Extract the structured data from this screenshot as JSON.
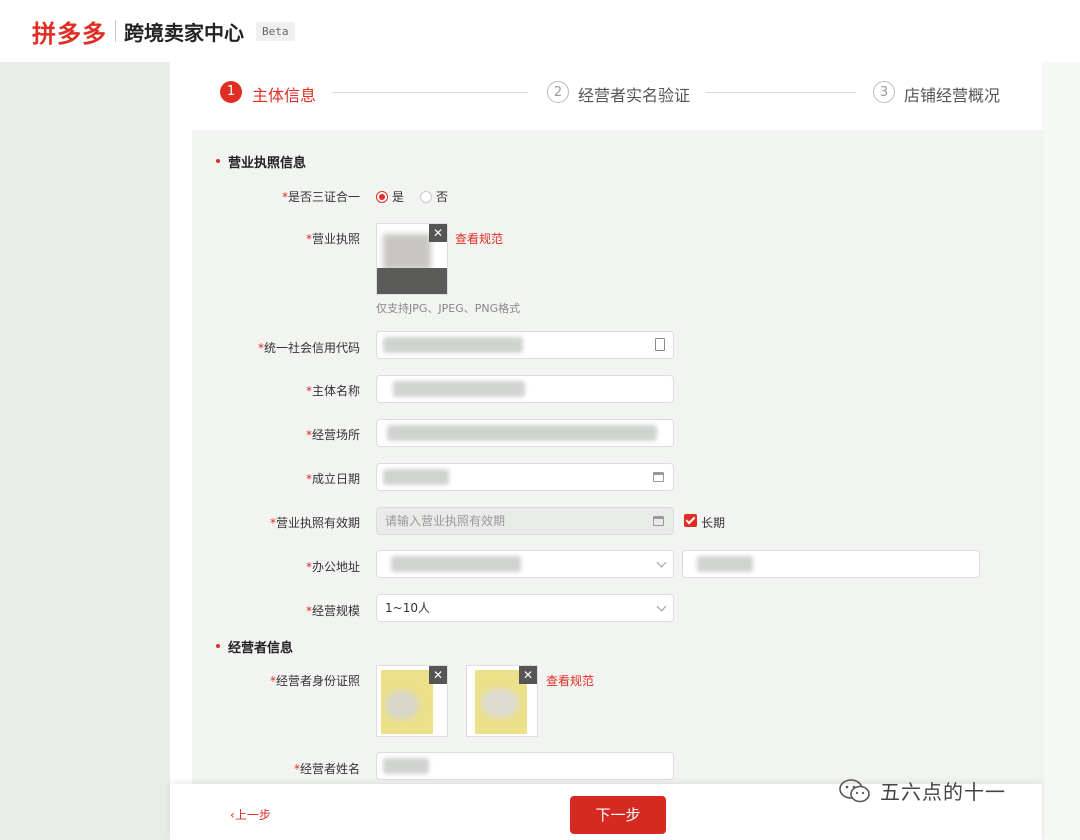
{
  "header": {
    "logo": "拼多多",
    "title": "跨境卖家中心",
    "badge": "Beta"
  },
  "steps": [
    {
      "num": "1",
      "label": "主体信息"
    },
    {
      "num": "2",
      "label": "经营者实名验证"
    },
    {
      "num": "3",
      "label": "店铺经营概况"
    }
  ],
  "sections": {
    "license": "营业执照信息",
    "operator": "经营者信息"
  },
  "fields": {
    "three_in_one": {
      "label": "是否三证合一",
      "yes": "是",
      "no": "否"
    },
    "license": {
      "label": "营业执照",
      "link": "查看规范",
      "hint": "仅支持JPG、JPEG、PNG格式"
    },
    "credit_code": {
      "label": "统一社会信用代码"
    },
    "entity_name": {
      "label": "主体名称"
    },
    "biz_place": {
      "label": "经营场所"
    },
    "found_date": {
      "label": "成立日期"
    },
    "validity": {
      "label": "营业执照有效期",
      "placeholder": "请输入营业执照有效期",
      "long_term": "长期"
    },
    "office_addr": {
      "label": "办公地址"
    },
    "scale": {
      "label": "经营规模",
      "value": "1~10人"
    },
    "id_photo": {
      "label": "经营者身份证照",
      "link": "查看规范"
    },
    "operator_name": {
      "label": "经营者姓名"
    }
  },
  "footer": {
    "prev": "上一步",
    "next": "下一步"
  },
  "watermark": "五六点的十一",
  "colors": {
    "accent": "#e02e24",
    "button": "#d42a22"
  }
}
